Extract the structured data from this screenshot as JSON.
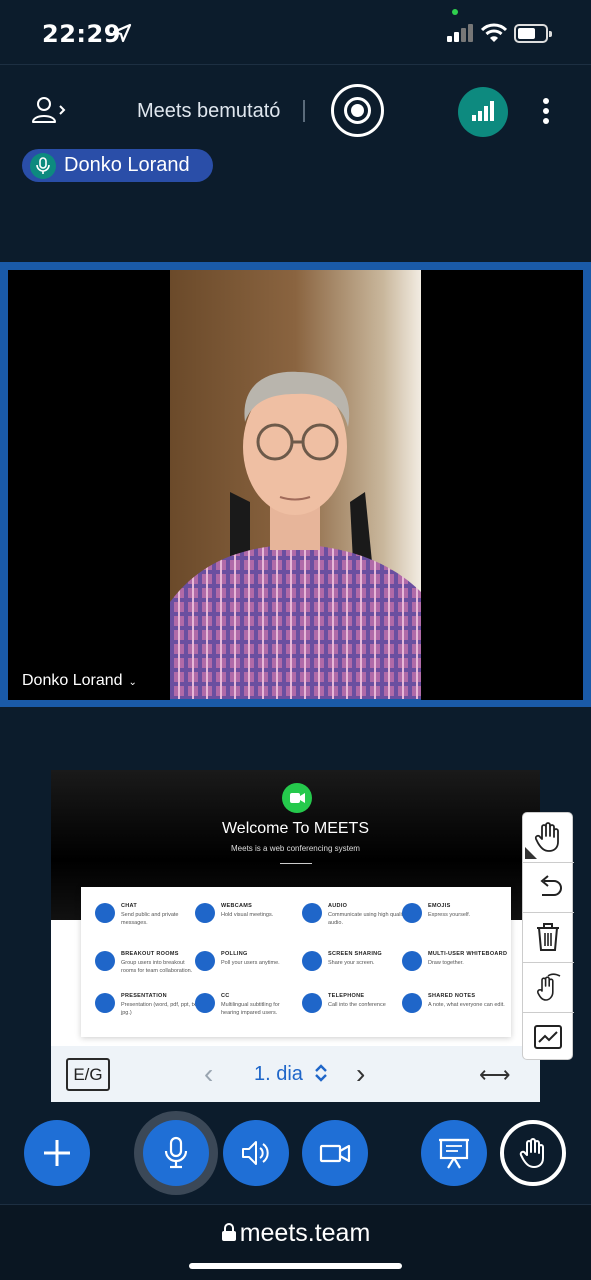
{
  "status_bar": {
    "time": "22:29",
    "location_icon": "location-arrow-icon",
    "signal_icon": "cellular-signal-icon",
    "wifi_icon": "wifi-icon",
    "battery_icon": "battery-icon",
    "battery_level": 0.55
  },
  "header": {
    "users_icon": "user-list-icon",
    "meeting_title": "Meets bemutató",
    "record_icon": "record-icon",
    "connection_icon": "connection-status-icon",
    "more_icon": "more-vertical-icon"
  },
  "talking_indicator": {
    "name": "Donko Lorand",
    "icon": "microphone-icon"
  },
  "video": {
    "participant_name": "Donko Lorand",
    "chevron": "⌄"
  },
  "presentation": {
    "logo_icon": "meets-logo-icon",
    "title": "Welcome To MEETS",
    "subtitle": "Meets is a web conferencing system",
    "features": [
      {
        "title": "CHAT",
        "desc": "Send public and private messages."
      },
      {
        "title": "WEBCAMS",
        "desc": "Hold visual meetings."
      },
      {
        "title": "AUDIO",
        "desc": "Communicate using high quality audio."
      },
      {
        "title": "EMOJIS",
        "desc": "Express yourself."
      },
      {
        "title": "BREAKOUT ROOMS",
        "desc": "Group users into breakout rooms for team collaboration."
      },
      {
        "title": "POLLING",
        "desc": "Poll your users anytime."
      },
      {
        "title": "SCREEN SHARING",
        "desc": "Share your screen."
      },
      {
        "title": "MULTI-USER WHITEBOARD",
        "desc": "Draw together."
      },
      {
        "title": "PRESENTATION",
        "desc": "Presentation (word, pdf, ppt, txt, jpg.)"
      },
      {
        "title": "CC",
        "desc": "Multilingual subtitling for hearing impared users."
      },
      {
        "title": "TELEPHONE",
        "desc": "Call into the conference"
      },
      {
        "title": "SHARED NOTES",
        "desc": "A note, what everyone can edit."
      }
    ],
    "controls": {
      "eg_label": "E/G",
      "prev": "‹",
      "slide_label": "1. dia",
      "next": "›",
      "fit": "⟷"
    }
  },
  "annotation_tools": [
    "hand-pan-icon",
    "undo-icon",
    "trash-icon",
    "multi-user-hand-icon",
    "chart-line-icon"
  ],
  "bottom_controls": [
    "add-icon",
    "microphone-icon",
    "speaker-icon",
    "camera-icon",
    "presentation-icon",
    "raise-hand-icon"
  ],
  "url_bar": {
    "lock_icon": "lock-icon",
    "url": "meets.team"
  },
  "colors": {
    "background": "#0c1c2c",
    "primary_blue": "#1f6fd6",
    "teal": "#0d8a7f",
    "talker_pill": "#2a4ea8"
  }
}
